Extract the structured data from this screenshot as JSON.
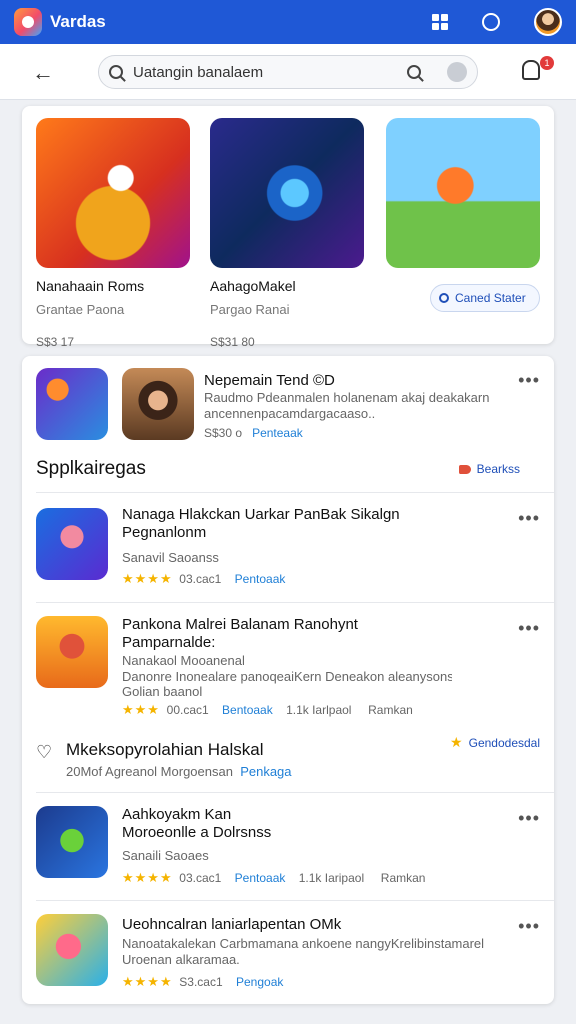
{
  "app": {
    "title": "Vardas"
  },
  "search": {
    "value": "Uatangin banalaem"
  },
  "notifications": {
    "count": "1"
  },
  "featured": [
    {
      "title": "Nanahaain Roms",
      "subtitle": "Grantae Paona",
      "price": "S$3 17"
    },
    {
      "title": "AahagoMakel",
      "subtitle": "Pargao Ranai",
      "price": "S$31 80"
    },
    {
      "title": "",
      "subtitle": "",
      "price": "",
      "chip": "Caned Stater"
    }
  ],
  "top_item": {
    "title": "Nepemain Tend ©D",
    "desc1": "Raudmo Pdeanmalen holanenam akaj deakakarn",
    "desc2": "ancennenpacamdargacaaso..",
    "size": "S$30 o",
    "action": "Penteaak"
  },
  "section1": {
    "title": "Spplkairegas",
    "link": "Bearkss"
  },
  "apps1": [
    {
      "title": "Nanaga Hlakckan Uarkar PanBak Sikalgn",
      "title2": "Pegnanlonm",
      "dev": "Sanavil Saoanss",
      "rating": "★★★★",
      "size": "03.cac1",
      "action": "Pentoaak"
    },
    {
      "title": "Pankona Malrei Balanam Ranohynt",
      "title2": "Pamparnalde:",
      "dev": "Nanakaol Mooanenal",
      "desc": "Danonre Inonealare panoqeaiKern Deneakon aleanysons.",
      "desc2": "Golian baanol",
      "size": "00.cac1",
      "action": "Bentoaak",
      "downloads": "1.1k Iarlpaol",
      "extra": "Ramkan"
    }
  ],
  "section2": {
    "title": "Mkeksopyrolahian Halskal",
    "subtitle": "20Mof Agreanol Morgoensan",
    "subtitle_link": "Penkaga",
    "link": "Gendodesdal"
  },
  "apps2": [
    {
      "title": "Aahkoyakm Kan",
      "title2": "Moroeonlle a Dolrsnss",
      "dev": "Sanaili Saoaes",
      "size": "03.cac1",
      "action": "Pentoaak",
      "downloads": "1.1k Iaripaol",
      "extra": "Ramkan"
    },
    {
      "title": "Ueohncalran laniarlapentan OMk",
      "desc": "Nanoatakalekan Carbmamana ankoene nangyKrelibinstamarel",
      "desc2": "Uroenan alkaramaa.",
      "size": "S3.cac1",
      "action": "Pengoak"
    }
  ],
  "colors": {
    "accent": "#1f58d6",
    "link": "#1f7fd6",
    "star": "#f5b400",
    "badge": "#e23a3a"
  }
}
